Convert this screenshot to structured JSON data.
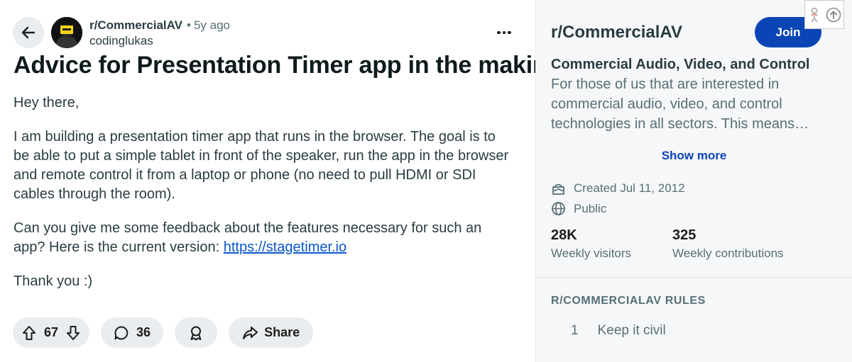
{
  "post": {
    "subreddit": "r/CommercialAV",
    "age": "5y ago",
    "separator": "•",
    "author": "codinglukas",
    "title": "Advice for Presentation Timer app in the making",
    "body": {
      "greeting": "Hey there,",
      "paragraph1": "I am building a presentation timer app that runs in the browser. The goal is to be able to put a simple tablet in front of the speaker, run the app in the browser and remote control it from a laptop or phone (no need to pull HDMI or SDI cables through the room).",
      "paragraph2_text": "Can you give me some feedback about the features necessary for such an app? Here is the current version: ",
      "paragraph2_link": "https://stagetimer.io",
      "closing": "Thank you :)"
    },
    "actions": {
      "upvotes": "67",
      "comments": "36",
      "share_label": "Share"
    }
  },
  "sidebar": {
    "name": "r/CommercialAV",
    "join_label": "Join",
    "tagline": "Commercial Audio, Video, and Control",
    "description": "For those of us that are interested in commercial audio, video, and control technologies in all sectors. This means…",
    "show_more_label": "Show more",
    "created": "Created Jul 11, 2012",
    "visibility": "Public",
    "stats": [
      {
        "value": "28K",
        "label": "Weekly visitors"
      },
      {
        "value": "325",
        "label": "Weekly contributions"
      }
    ],
    "rules_heading": "R/COMMERCIALAV RULES",
    "rules": [
      {
        "number": "1",
        "text": "Keep it civil"
      }
    ]
  },
  "icons": {
    "back": "arrow-left-icon",
    "more": "ellipsis-icon",
    "upvote": "arrow-up-icon",
    "downvote": "arrow-down-icon",
    "comment": "comment-bubble-icon",
    "award": "award-icon",
    "share": "share-arrow-icon",
    "cake": "cake-icon",
    "globe": "globe-icon"
  },
  "colors": {
    "join_button": "#0a45b5",
    "link": "#0a58ca",
    "pill_bg": "#eaedef",
    "sidebar_bg": "#f6f7f8"
  }
}
